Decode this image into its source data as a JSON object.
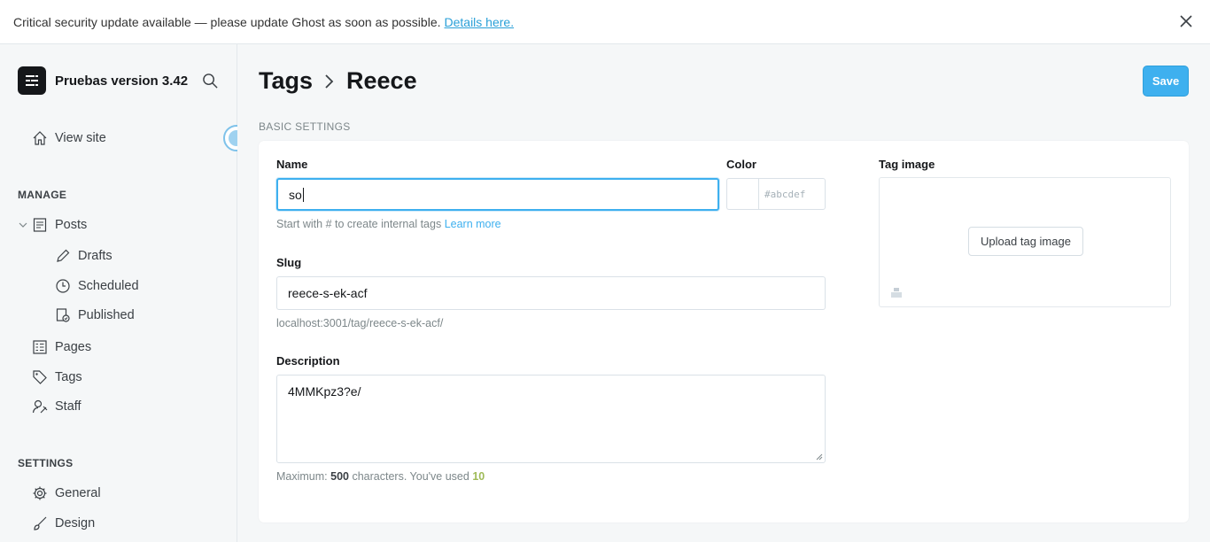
{
  "alert": {
    "message": "Critical security update available — please update Ghost as soon as possible.",
    "link": "Details here."
  },
  "sidebar": {
    "site_title": "Pruebas version 3.42",
    "view_site": "View site",
    "manage_label": "MANAGE",
    "items": [
      {
        "label": "Posts",
        "icon": "posts-icon"
      },
      {
        "label": "Drafts",
        "icon": "pencil-icon"
      },
      {
        "label": "Scheduled",
        "icon": "clock-icon"
      },
      {
        "label": "Published",
        "icon": "published-icon"
      },
      {
        "label": "Pages",
        "icon": "pages-icon"
      },
      {
        "label": "Tags",
        "icon": "tag-icon"
      },
      {
        "label": "Staff",
        "icon": "staff-icon"
      }
    ],
    "settings_label": "SETTINGS",
    "settings_items": [
      {
        "label": "General",
        "icon": "gear-icon"
      },
      {
        "label": "Design",
        "icon": "brush-icon"
      }
    ]
  },
  "header": {
    "breadcrumb_parent": "Tags",
    "breadcrumb_current": "Reece",
    "save_label": "Save"
  },
  "form": {
    "section_label": "BASIC SETTINGS",
    "name_label": "Name",
    "name_value": "so",
    "name_hint": "Start with # to create internal tags",
    "name_hint_link": "Learn more",
    "color_label": "Color",
    "color_placeholder": "#abcdef",
    "slug_label": "Slug",
    "slug_value": "reece-s-ek-acf",
    "slug_url": "localhost:3001/tag/reece-s-ek-acf/",
    "description_label": "Description",
    "description_value": "4MMKpz3?e/",
    "description_hint_prefix": "Maximum:",
    "description_max": "500",
    "description_hint_mid": "characters. You've used",
    "description_used": "10",
    "tag_image_label": "Tag image",
    "upload_label": "Upload tag image"
  },
  "colors": {
    "accent": "#3eb0ef",
    "used_count": "#9fbb58",
    "sidebar_bg": "#f5f7f8"
  }
}
